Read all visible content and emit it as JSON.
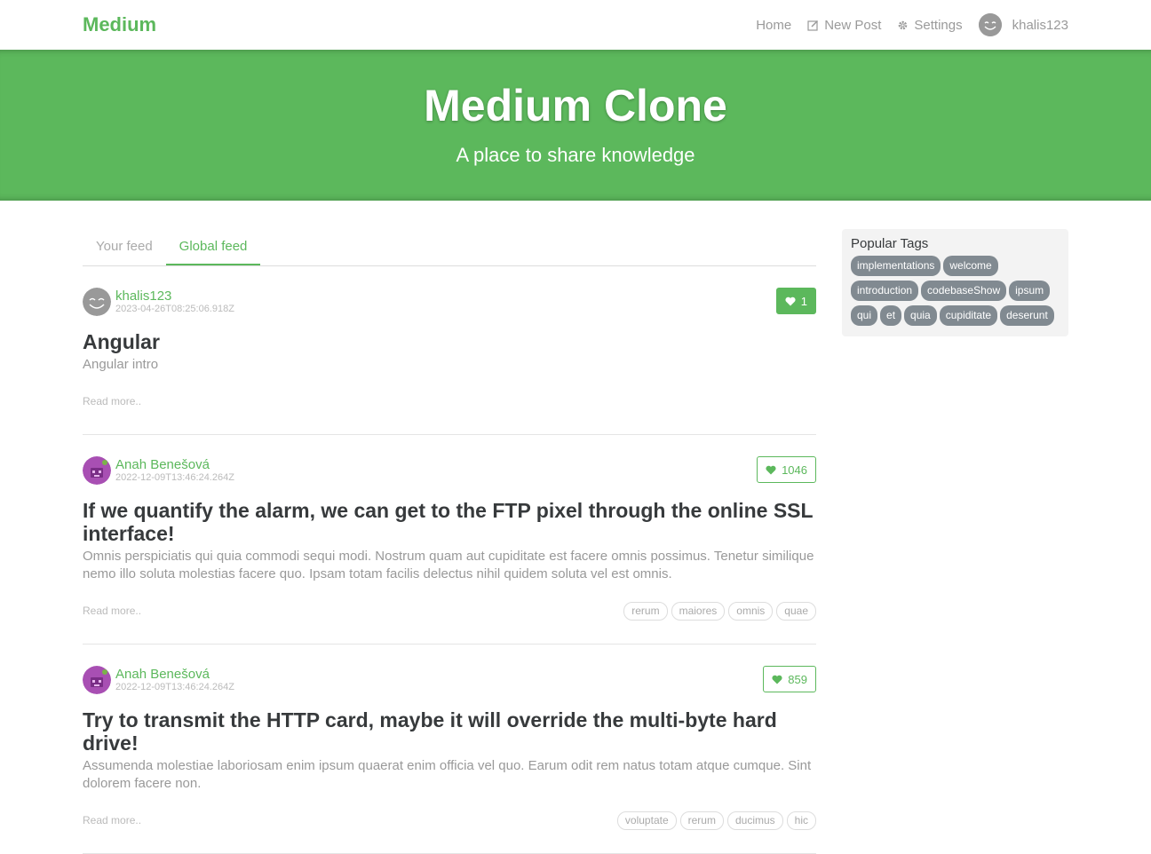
{
  "navbar": {
    "brand": "Medium",
    "links": [
      {
        "label": "Home",
        "icon": "none"
      },
      {
        "label": "New Post",
        "icon": "edit-icon"
      },
      {
        "label": "Settings",
        "icon": "gear-icon"
      }
    ],
    "user": "khalis123"
  },
  "banner": {
    "title": "Medium Clone",
    "subtitle": "A place to share knowledge"
  },
  "feed": {
    "tabs": [
      {
        "label": "Your feed",
        "active": false
      },
      {
        "label": "Global feed",
        "active": true
      }
    ],
    "read_more": "Read more..",
    "articles": [
      {
        "author": "khalis123",
        "date": "2023-04-26T08:25:06.918Z",
        "likes": "1",
        "liked": true,
        "title": "Angular",
        "description": "Angular intro",
        "tags": []
      },
      {
        "author": "Anah Benešová",
        "date": "2022-12-09T13:46:24.264Z",
        "likes": "1046",
        "liked": false,
        "title": "If we quantify the alarm, we can get to the FTP pixel through the online SSL interface!",
        "description": "Omnis perspiciatis qui quia commodi sequi modi. Nostrum quam aut cupiditate est facere omnis possimus. Tenetur similique nemo illo soluta molestias facere quo. Ipsam totam facilis delectus nihil quidem soluta vel est omnis.",
        "tags": [
          "rerum",
          "maiores",
          "omnis",
          "quae"
        ]
      },
      {
        "author": "Anah Benešová",
        "date": "2022-12-09T13:46:24.264Z",
        "likes": "859",
        "liked": false,
        "title": "Try to transmit the HTTP card, maybe it will override the multi-byte hard drive!",
        "description": "Assumenda molestiae laboriosam enim ipsum quaerat enim officia vel quo. Earum odit rem natus totam atque cumque. Sint dolorem facere non.",
        "tags": [
          "voluptate",
          "rerum",
          "ducimus",
          "hic"
        ]
      }
    ]
  },
  "sidebar": {
    "heading": "Popular Tags",
    "tags": [
      "implementations",
      "welcome",
      "introduction",
      "codebaseShow",
      "ipsum",
      "qui",
      "et",
      "quia",
      "cupiditate",
      "deserunt"
    ]
  },
  "colors": {
    "accent": "#5cb85c",
    "tag_pill": "#818a91"
  }
}
